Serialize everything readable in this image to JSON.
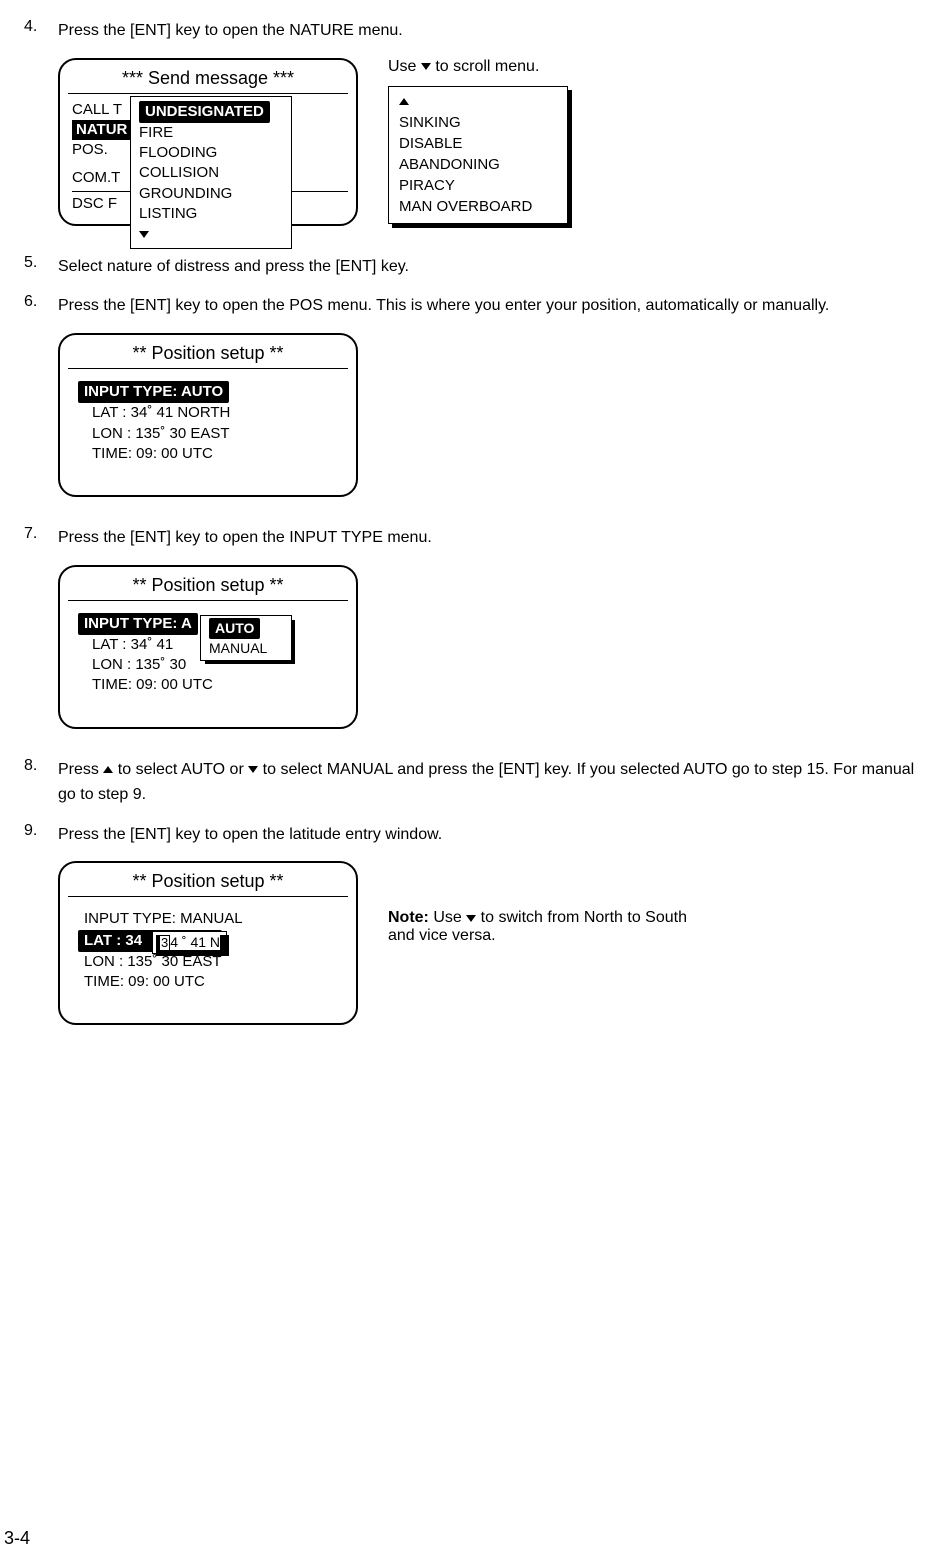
{
  "steps": {
    "s4": {
      "num": "4.",
      "text": "Press the [ENT] key to open the NATURE menu."
    },
    "s5": {
      "num": "5.",
      "text": "Select nature of distress and press the [ENT] key."
    },
    "s6": {
      "num": "6.",
      "text": "Press the [ENT] key to open the POS menu. This is where you enter your position, automatically or manually."
    },
    "s7": {
      "num": "7.",
      "text": "Press the [ENT] key to open the INPUT TYPE menu."
    },
    "s8": {
      "num": "8.",
      "text_a": "Press ",
      "text_b": " to select AUTO or ",
      "text_c": " to select MANUAL and press the [ENT] key. If you selected AUTO go to step 15. For manual go to step 9."
    },
    "s9": {
      "num": "9.",
      "text": "Press the [ENT] key to open the latitude entry window."
    }
  },
  "fig1": {
    "title": "*** Send message ***",
    "left": {
      "l1": "CALL T",
      "l2": "NATUR",
      "l3": "POS.",
      "l4": "COM.T",
      "l5": "DSC F"
    },
    "popup": {
      "sel": "UNDESIGNATED",
      "i2": "FIRE",
      "i3": "FLOODING",
      "i4": "COLLISION",
      "i5": "GROUNDING",
      "i6": "LISTING"
    },
    "scroll_note_a": "Use ",
    "scroll_note_b": " to scroll menu.",
    "scroll_box": {
      "i1": "SINKING",
      "i2": "DISABLE",
      "i3": "ABANDONING",
      "i4": "PIRACY",
      "i5": "MAN OVERBOARD"
    }
  },
  "fig2": {
    "title": "**      Position setup      **",
    "sel": "INPUT  TYPE: AUTO",
    "lat": "LAT  :   34˚ 41 NORTH",
    "lon": "LON : 135˚ 30 EAST",
    "time": "TIME:   09: 00 UTC"
  },
  "fig3": {
    "title": "**      Position setup      **",
    "sel": "INPUT  TYPE: A",
    "lat": "LAT  :   34˚ 41",
    "lon": "LON : 135˚ 30",
    "time": "TIME:   09: 00 UTC",
    "popup": {
      "sel": "AUTO",
      "i2": "MANUAL"
    }
  },
  "fig4": {
    "title": "**      Position setup      **",
    "l1": "INPUT  TYPE: MANUAL",
    "sel": "LAT :   34",
    "lon": "LON : 135˚ 30 EAST",
    "time": "TIME:   09: 00 UTC",
    "entry_rest": "4 ˚ 41 N",
    "note_bold": "Note:",
    "note_a": " Use ",
    "note_b": " to switch from North to South and vice versa."
  },
  "page_num": "3-4"
}
